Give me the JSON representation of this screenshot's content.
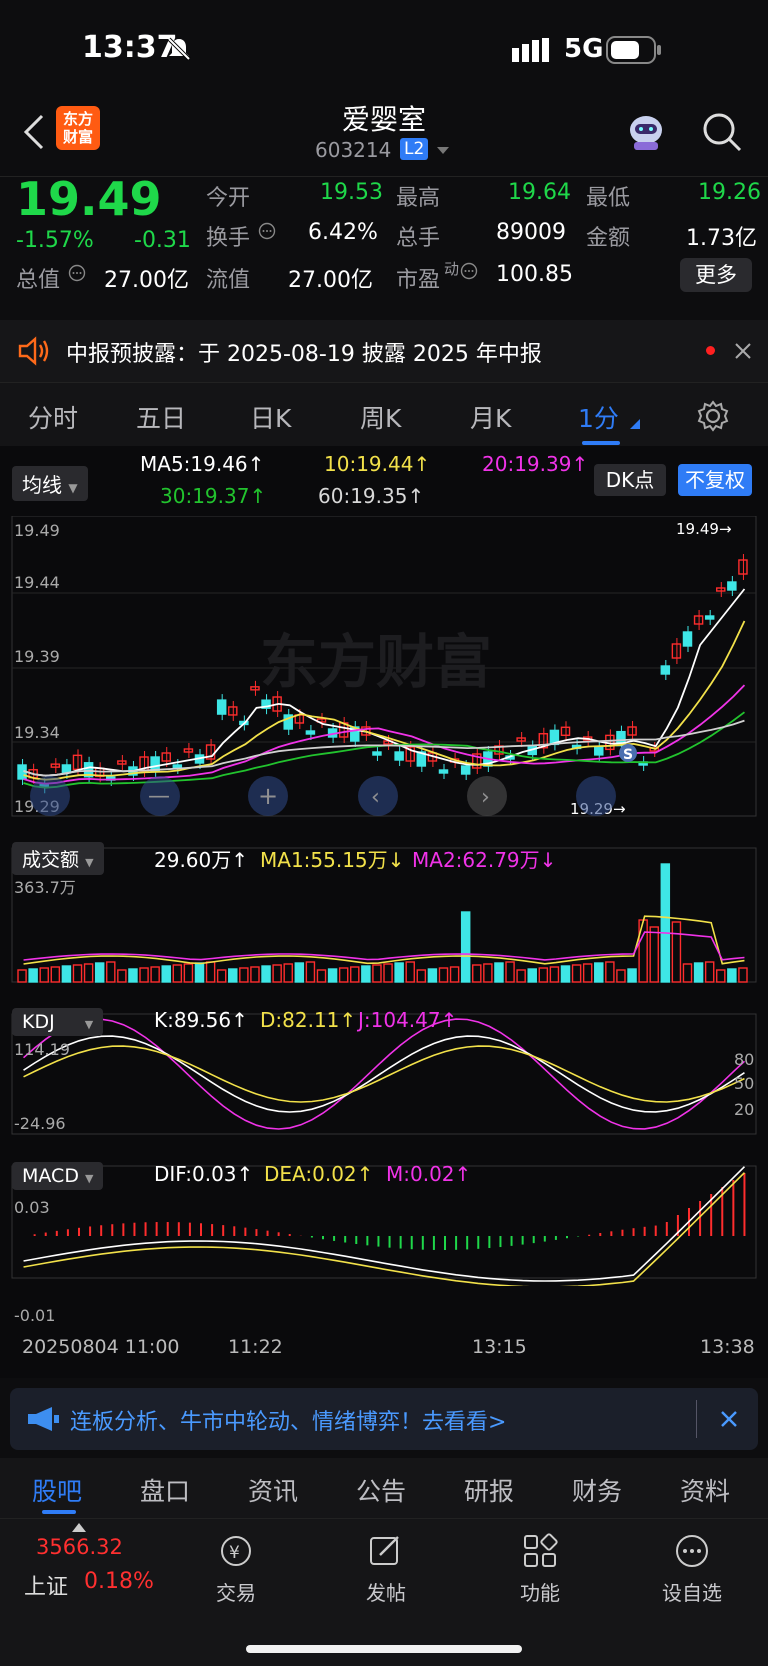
{
  "status": {
    "time": "13:37",
    "network": "5G"
  },
  "header": {
    "back_icon": "chevron-left-icon",
    "logo_text": "东方\n财富",
    "stock_name": "爱婴室",
    "stock_code": "603214",
    "level_badge": "L2",
    "robot_icon": "robot-icon",
    "search_icon": "search-icon"
  },
  "quote": {
    "price": "19.49",
    "pct": "-1.57%",
    "change": "-0.31",
    "open_label": "今开",
    "open": "19.53",
    "high_label": "最高",
    "high": "19.64",
    "low_label": "最低",
    "low": "19.26",
    "turnover_label": "换手",
    "turnover": "6.42%",
    "volume_label": "总手",
    "volume": "89009",
    "amount_label": "金额",
    "amount": "1.73亿",
    "mktcap_label": "总值",
    "mktcap": "27.00亿",
    "float_label": "流值",
    "float": "27.00亿",
    "pe_label": "市盈",
    "pe_sup": "动",
    "pe": "100.85",
    "more": "更多"
  },
  "notice": {
    "text": "中报预披露：于 2025-08-19 披露 2025 年中报"
  },
  "tabs": [
    "分时",
    "五日",
    "日K",
    "周K",
    "月K",
    "1分"
  ],
  "active_tab": "1分",
  "ma": {
    "selector": "均线",
    "ma5": "MA5:19.46↑",
    "ma10": "10:19.44↑",
    "ma20": "20:19.39↑",
    "ma30": "30:19.37↑",
    "ma60": "60:19.35↑",
    "dk": "DK点",
    "restore": "不复权"
  },
  "price_axis": [
    "19.49",
    "19.44",
    "19.39",
    "19.34",
    "19.29"
  ],
  "price_marks": {
    "high_mark": "19.49→",
    "low_mark": "19.29→",
    "s_marker": "S"
  },
  "watermark": "东方财富",
  "volume": {
    "selector": "成交额",
    "value": "29.60万↑",
    "ma1": "MA1:55.15万↓",
    "ma2": "MA2:62.79万↓",
    "max_label": "363.7万"
  },
  "kdj": {
    "selector": "KDJ",
    "k": "K:89.56↑",
    "d": "D:82.11↑",
    "j": "J:104.47↑",
    "top_label": "114.19",
    "bottom_label": "-24.96",
    "levels": [
      "80",
      "50",
      "20"
    ]
  },
  "macd": {
    "selector": "MACD",
    "dif": "DIF:0.03↑",
    "dea": "DEA:0.02↑",
    "m": "M:0.02↑",
    "top_label": "0.03",
    "bottom_label": "-0.01"
  },
  "time_axis": [
    "20250804 11:00",
    "11:22",
    "13:15",
    "13:38"
  ],
  "banner": {
    "text": "连板分析、牛市中轮动、情绪博弈！去看看>"
  },
  "bottom_tabs": [
    "股吧",
    "盘口",
    "资讯",
    "公告",
    "研报",
    "财务",
    "资料"
  ],
  "dock": {
    "index_value": "3566.32",
    "index_name": "上证",
    "index_pct": "0.18%",
    "items": [
      "交易",
      "发帖",
      "功能",
      "设自选"
    ]
  },
  "colors": {
    "up": "#ff2d2d",
    "down": "#1fd84a",
    "cyan": "#3ee6e6",
    "accent": "#2f7cf6"
  }
}
